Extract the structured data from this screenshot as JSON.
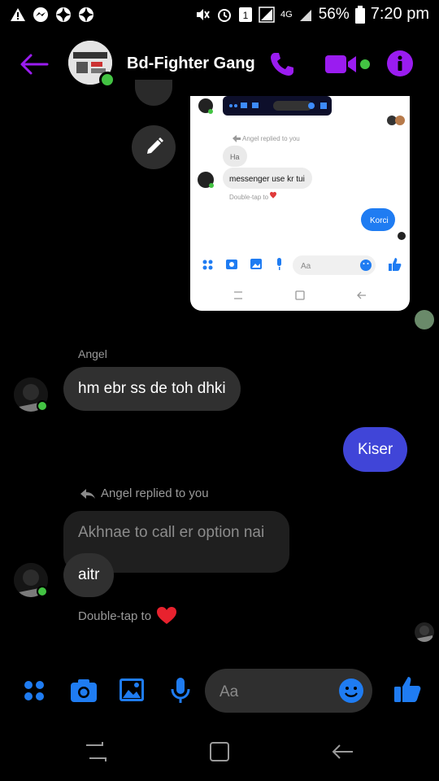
{
  "status_bar": {
    "battery": "56%",
    "time": "7:20 pm",
    "network": "4G"
  },
  "header": {
    "title": "Bd-Fighter Gang",
    "accent_color": "#9a1cf0"
  },
  "screenshot_preview": {
    "replied_label": "Angel replied to you",
    "reply_quote": "Ha",
    "message": "messenger use kr tui",
    "double_tap": "Double-tap to",
    "own_message": "Korci",
    "composer_placeholder": "Aa"
  },
  "messages": {
    "sender1": "Angel",
    "msg1": "hm ebr ss de toh dhki",
    "own1": "Kiser",
    "replied_label": "Angel replied to you",
    "quoted": "Akhnae to call er option nai",
    "msg2": "aitr",
    "double_tap": "Double-tap to"
  },
  "composer": {
    "placeholder": "Aa"
  },
  "colors": {
    "blue": "#1f7cf2",
    "bubble_out": "#4045d8",
    "bubble_in": "#303030",
    "online": "#43c343"
  }
}
